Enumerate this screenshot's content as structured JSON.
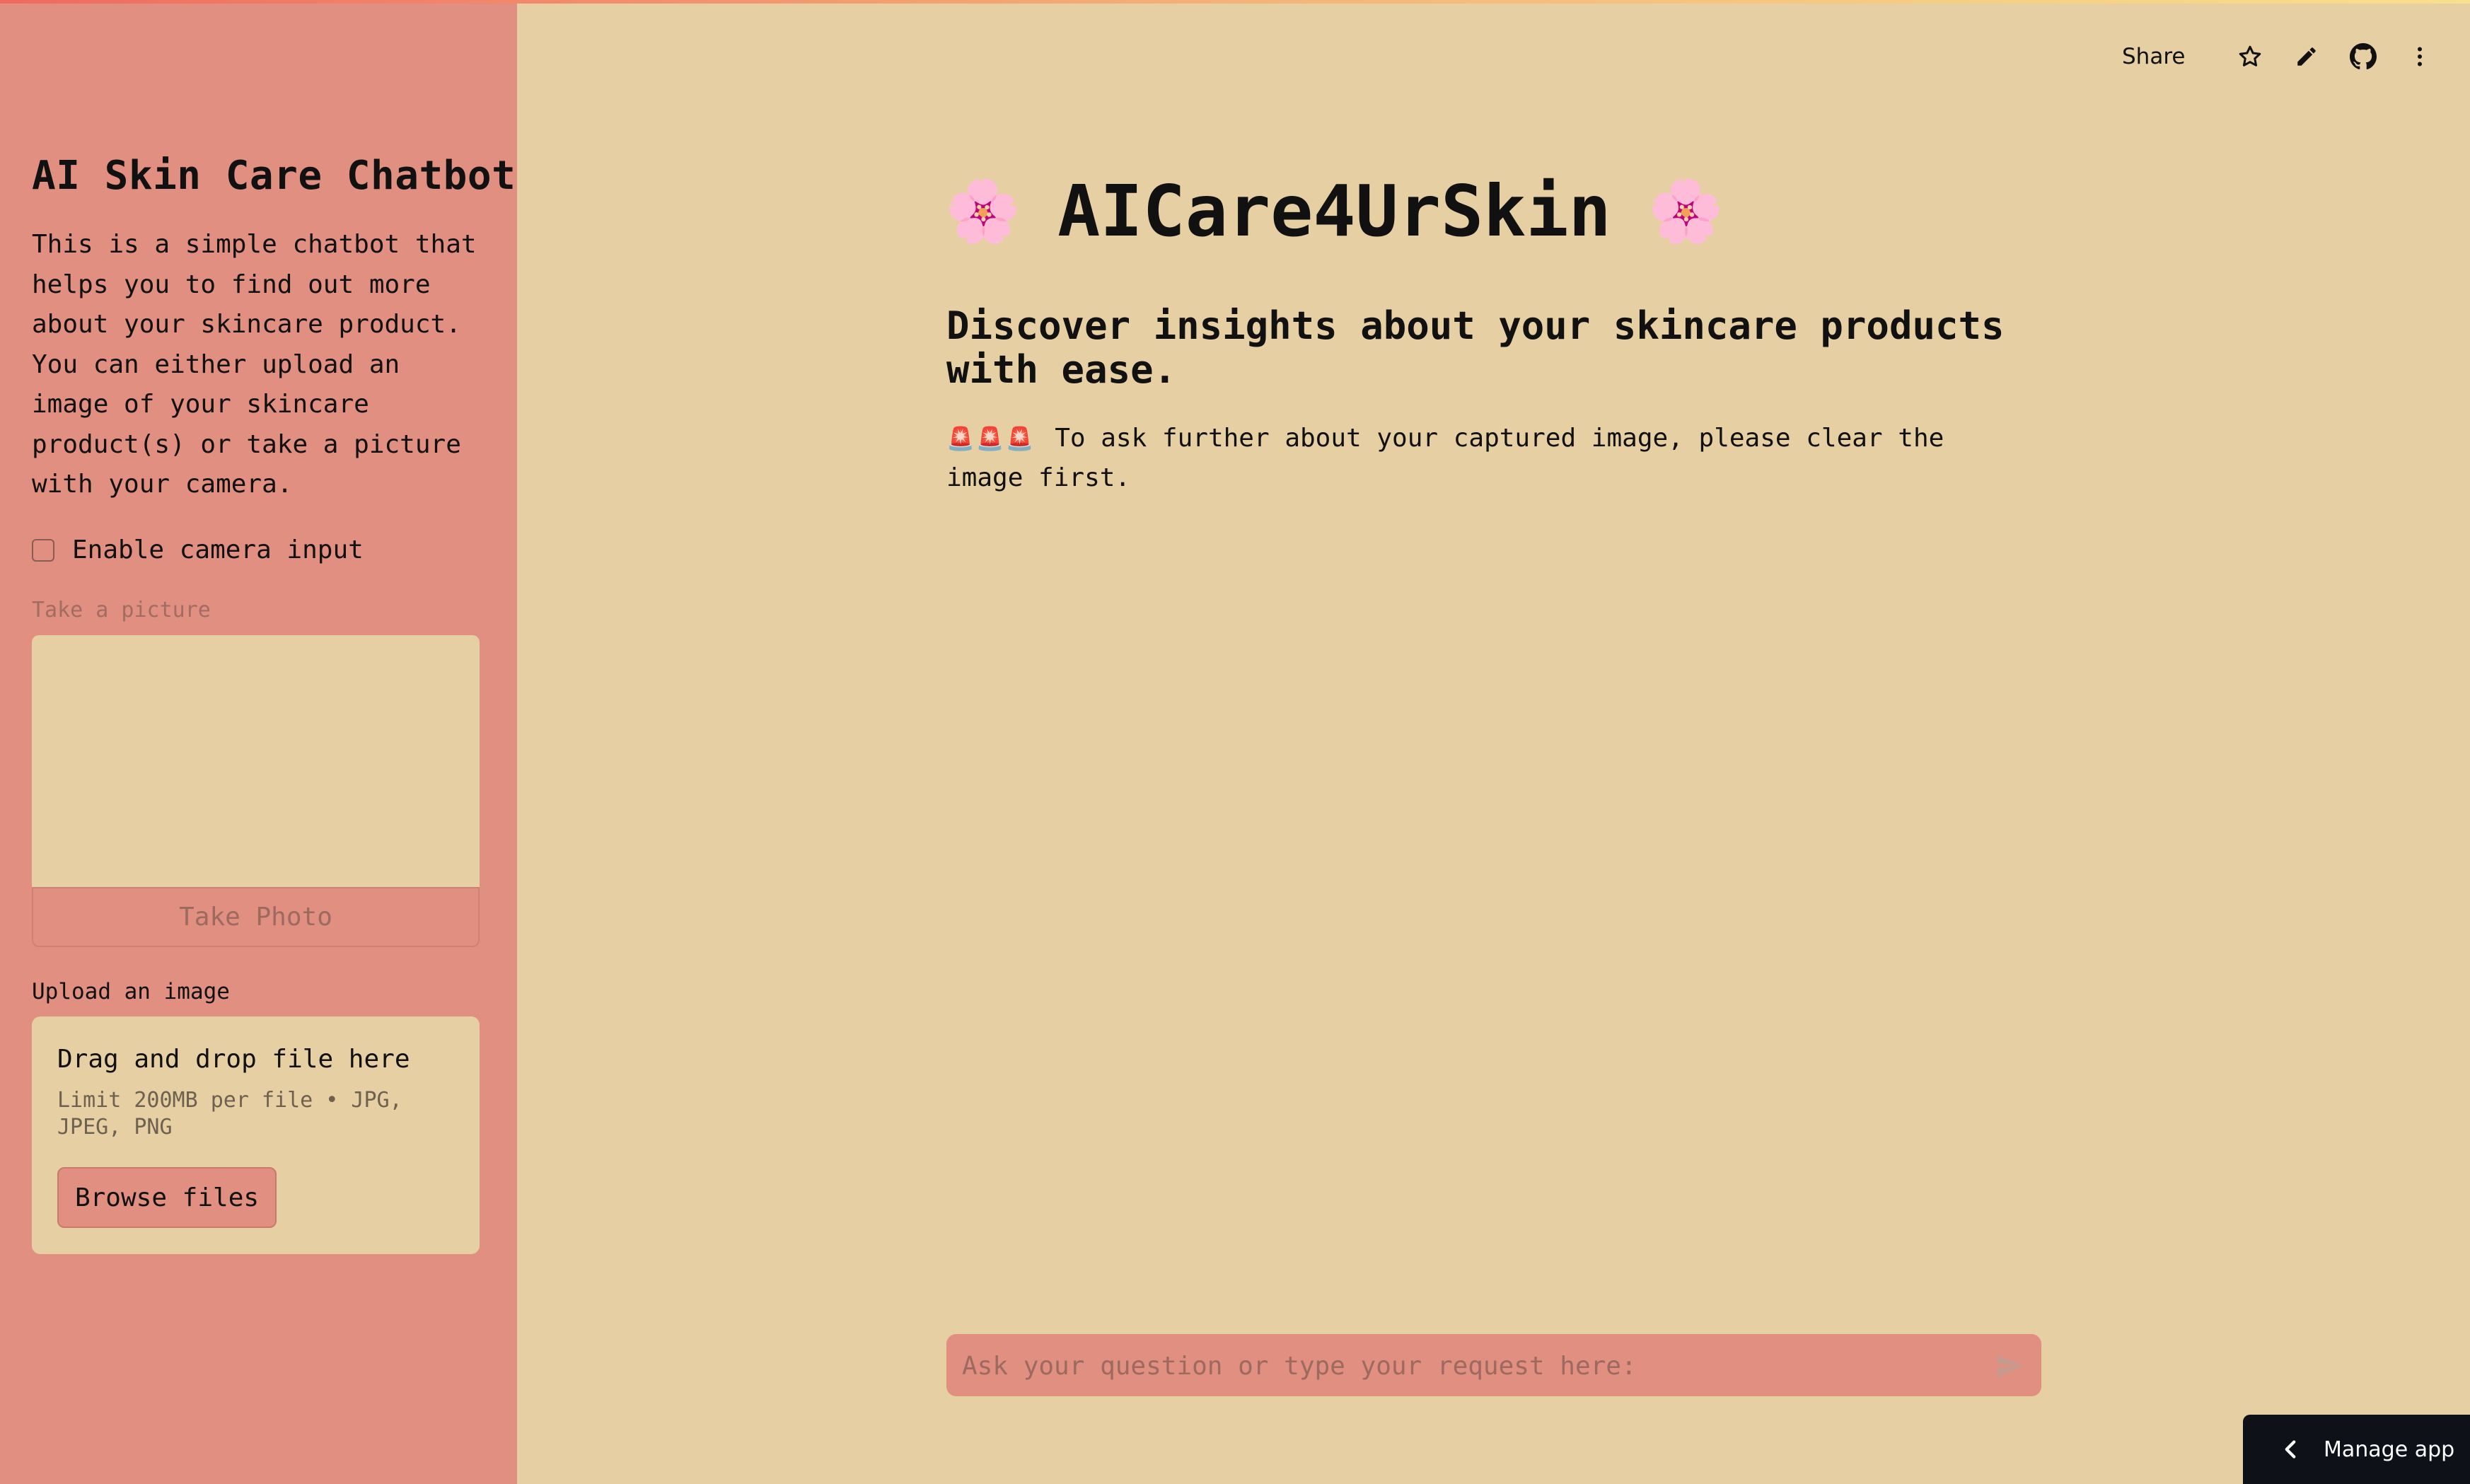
{
  "sidebar": {
    "title": "AI Skin Care Chatbot",
    "description": "This is a simple chatbot that helps you to find out more about your skincare product. You can either upload an image of your skincare product(s) or take a picture with your camera.",
    "camera_checkbox": {
      "label": "Enable camera input",
      "checked": false
    },
    "camera": {
      "label": "Take a picture",
      "button_label": "Take Photo",
      "disabled": true
    },
    "uploader": {
      "label": "Upload an image",
      "drop_title": "Drag and drop file here",
      "limits": "Limit 200MB per file • JPG, JPEG, PNG",
      "browse_label": "Browse files"
    }
  },
  "header": {
    "share_label": "Share",
    "icons": [
      "star-icon",
      "pencil-icon",
      "github-icon",
      "more-vertical-icon"
    ]
  },
  "main": {
    "title": "AICare4UrSkin",
    "title_emoji": "🌸",
    "subheading": "Discover insights about your skincare products with ease.",
    "notice_emoji": "🚨🚨🚨",
    "notice": "To ask further about your captured image, please clear the image first."
  },
  "chat_input": {
    "placeholder": "Ask your question or type your request here:",
    "value": ""
  },
  "manage_app": {
    "label": "Manage app"
  },
  "colors": {
    "background": "#e5cfa3",
    "sidebar": "#e08f80",
    "text": "#111111",
    "manage_bar": "#0e1117"
  }
}
